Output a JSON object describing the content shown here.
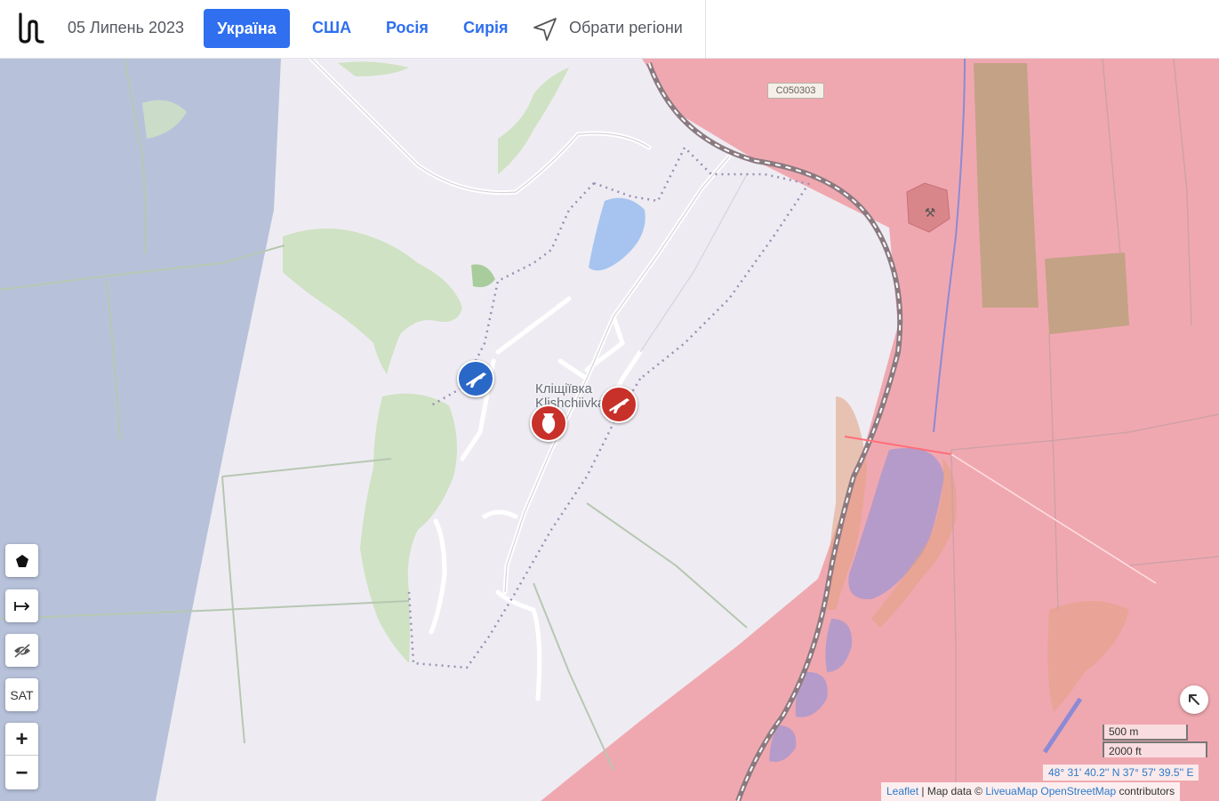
{
  "header": {
    "logo_icon": "liveuamap-logo-icon",
    "date": "05 Липень 2023",
    "tabs": [
      {
        "label": "Україна",
        "active": true
      },
      {
        "label": "США",
        "active": false
      },
      {
        "label": "Росія",
        "active": false
      },
      {
        "label": "Сирія",
        "active": false
      }
    ],
    "region_selector": {
      "icon": "navigation-arrow-icon",
      "label": "Обрати регіони"
    }
  },
  "map": {
    "place_label_line1": "Кліщіївка",
    "place_label_line2": "Klishchiivka",
    "road_label": "С050303",
    "zones": [
      {
        "name": "ukraine-controlled",
        "color": "#b7c2da"
      },
      {
        "name": "russia-controlled",
        "color": "#f0a8b0"
      }
    ],
    "markers": [
      {
        "name": "ukraine-assault-rifle-icon",
        "side": "Ukraine",
        "color": "#2a68c8"
      },
      {
        "name": "russia-assault-rifle-icon",
        "side": "Russia",
        "color": "#c8302a"
      },
      {
        "name": "russia-bomb-icon",
        "side": "Russia",
        "color": "#c8302a"
      }
    ],
    "controls": {
      "polygon_icon": "pentagon-icon",
      "measure_icon": "measure-arrow-icon",
      "hide_icon": "eye-slash-icon",
      "sat_label": "SAT",
      "zoom_in": "+",
      "zoom_out": "−"
    },
    "scale": {
      "metric": "500 m",
      "imperial": "2000 ft"
    },
    "coordinates": "48° 31' 40.2'' N 37° 57' 39.5'' E",
    "attribution": {
      "leaflet": "Leaflet",
      "separator": " | Map data © ",
      "liveuamap": "LiveuaMap",
      "osm": "OpenStreetMap",
      "suffix": " contributors"
    }
  }
}
